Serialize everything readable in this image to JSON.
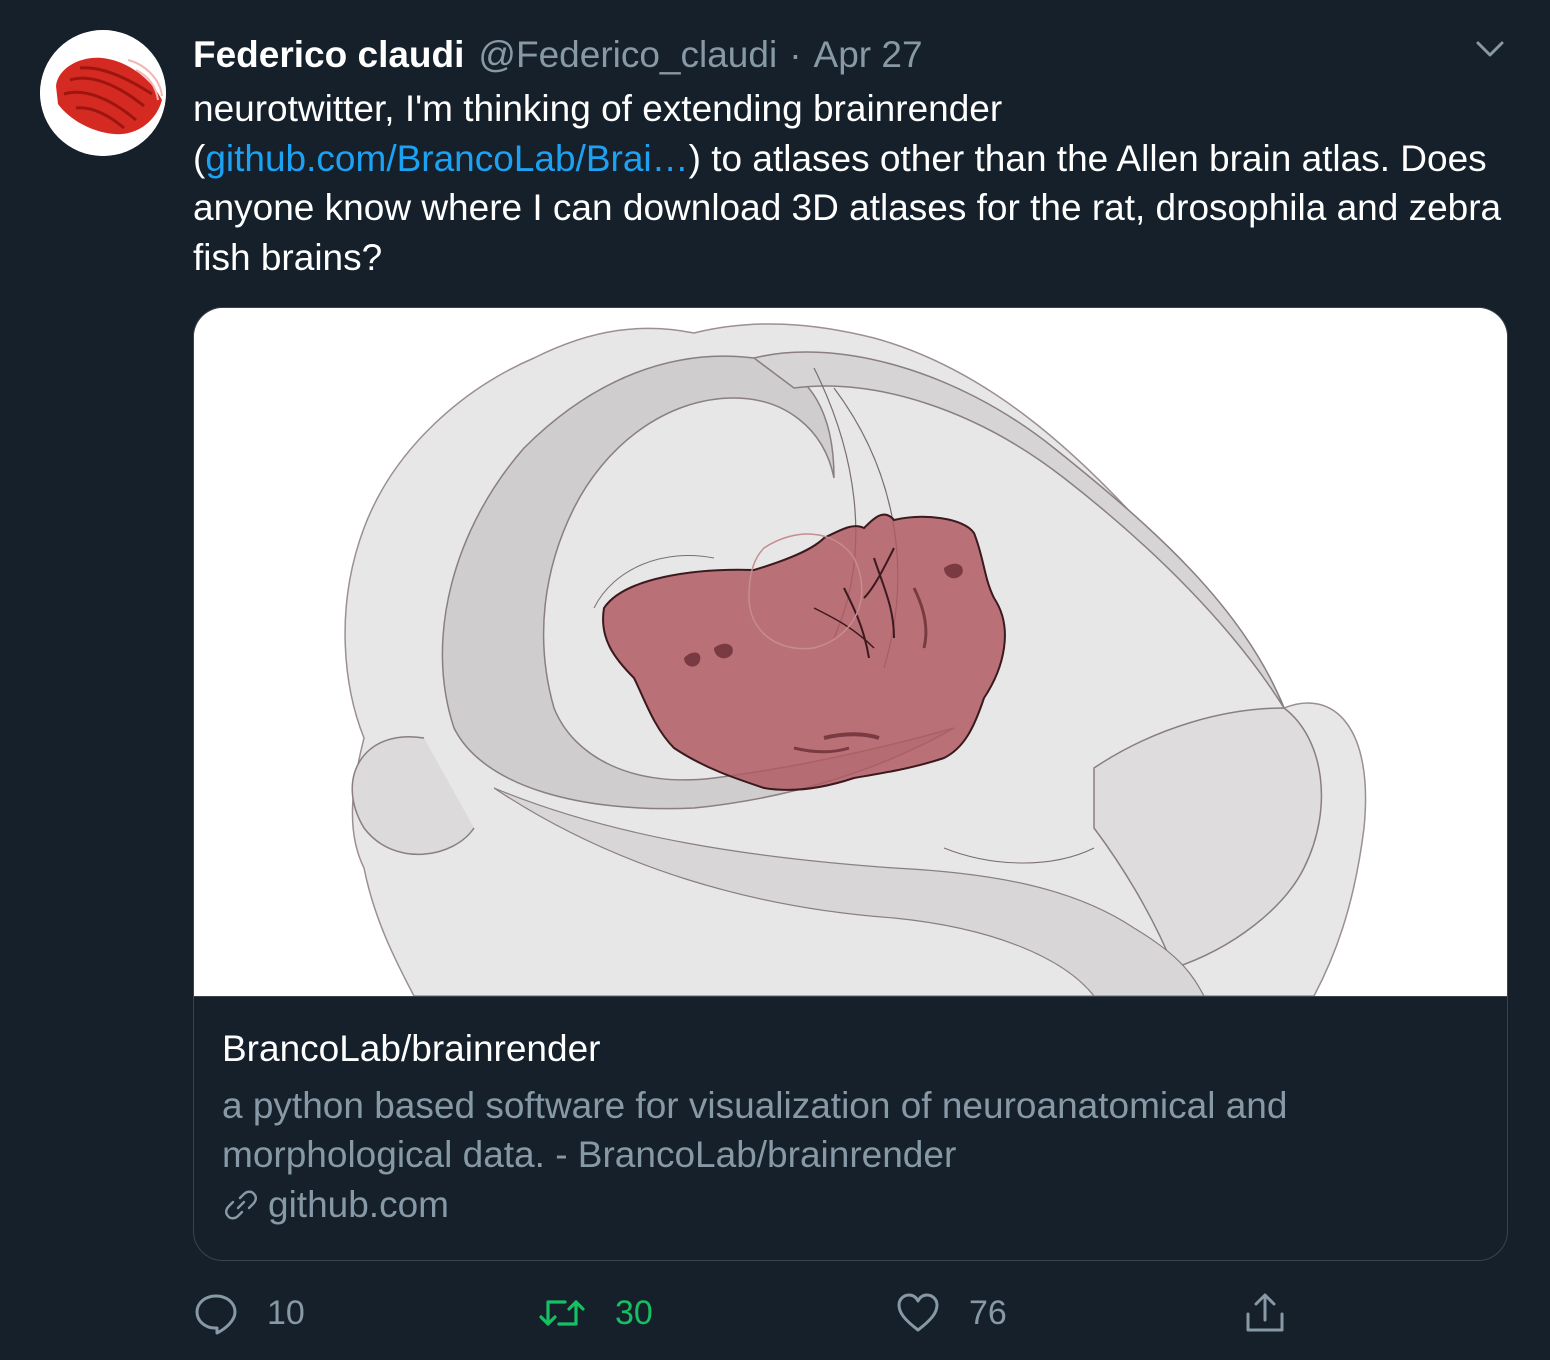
{
  "author": {
    "name": "Federico claudi",
    "handle": "@Federico_claudi",
    "separator": "·",
    "date": "Apr 27",
    "avatar_icon": "red-brain-render-avatar"
  },
  "tweet": {
    "text_part1": "neurotwitter, I'm thinking of extending brainrender (",
    "link": "github.com/BrancoLab/Brai…",
    "text_part2": ") to atlases other than the Allen brain atlas. Does anyone know where I can download 3D atlases for the rat, drosophila and zebra fish brains?"
  },
  "card": {
    "image_icon": "brain-render-image",
    "title": "BrancoLab/brainrender",
    "description": "a python based software for visualization of neuroanatomical and morphological data. - BrancoLab/brainrender",
    "domain": "github.com",
    "domain_icon": "link-icon"
  },
  "actions": {
    "reply_count": "10",
    "retweet_count": "30",
    "like_count": "76",
    "reply_icon": "reply-icon",
    "retweet_icon": "retweet-icon",
    "like_icon": "heart-icon",
    "share_icon": "share-icon"
  },
  "colors": {
    "background": "#15202b",
    "text": "#ffffff",
    "secondary": "#8899a6",
    "link": "#1da1f2",
    "retweet_active": "#17bf63",
    "border": "#38444d",
    "brain_region": "#b05a63"
  }
}
